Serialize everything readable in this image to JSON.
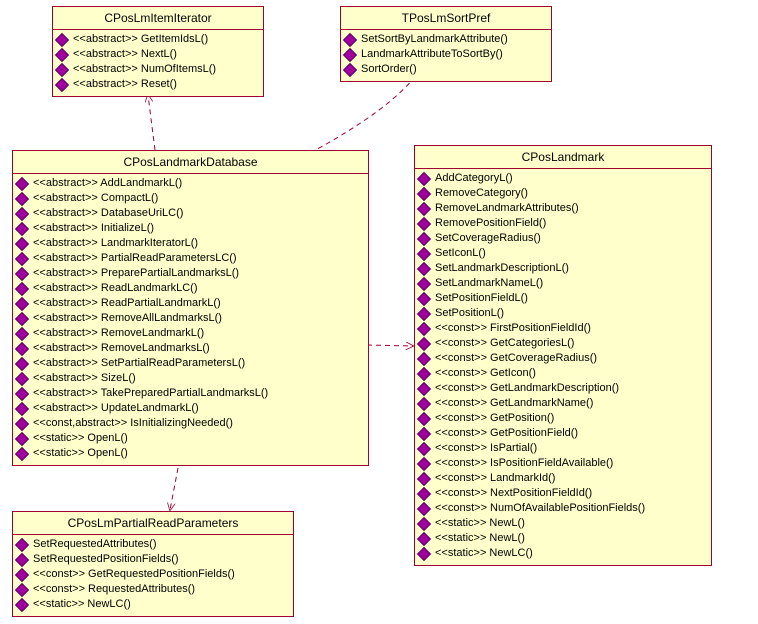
{
  "classes": {
    "iterator": {
      "title": "CPosLmItemIterator",
      "methods": [
        "<<abstract>> GetItemIdsL()",
        "<<abstract>> NextL()",
        "<<abstract>> NumOfItemsL()",
        "<<abstract>> Reset()"
      ]
    },
    "sortpref": {
      "title": "TPosLmSortPref",
      "methods": [
        "SetSortByLandmarkAttribute()",
        "LandmarkAttributeToSortBy()",
        "SortOrder()"
      ]
    },
    "database": {
      "title": "CPosLandmarkDatabase",
      "methods": [
        "<<abstract>> AddLandmarkL()",
        "<<abstract>> CompactL()",
        "<<abstract>> DatabaseUriLC()",
        "<<abstract>> InitializeL()",
        "<<abstract>> LandmarkIteratorL()",
        "<<abstract>> PartialReadParametersLC()",
        "<<abstract>> PreparePartialLandmarksL()",
        "<<abstract>> ReadLandmarkLC()",
        "<<abstract>> ReadPartialLandmarkL()",
        "<<abstract>> RemoveAllLandmarksL()",
        "<<abstract>> RemoveLandmarkL()",
        "<<abstract>> RemoveLandmarksL()",
        "<<abstract>> SetPartialReadParametersL()",
        "<<abstract>> SizeL()",
        "<<abstract>> TakePreparedPartialLandmarksL()",
        "<<abstract>> UpdateLandmarkL()",
        "<<const,abstract>> IsInitializingNeeded()",
        "<<static>> OpenL()",
        "<<static>> OpenL()"
      ]
    },
    "landmark": {
      "title": "CPosLandmark",
      "methods": [
        "AddCategoryL()",
        "RemoveCategory()",
        "RemoveLandmarkAttributes()",
        "RemovePositionField()",
        "SetCoverageRadius()",
        "SetIconL()",
        "SetLandmarkDescriptionL()",
        "SetLandmarkNameL()",
        "SetPositionFieldL()",
        "SetPositionL()",
        "<<const>> FirstPositionFieldId()",
        "<<const>> GetCategoriesL()",
        "<<const>> GetCoverageRadius()",
        "<<const>> GetIcon()",
        "<<const>> GetLandmarkDescription()",
        "<<const>> GetLandmarkName()",
        "<<const>> GetPosition()",
        "<<const>> GetPositionField()",
        "<<const>> IsPartial()",
        "<<const>> IsPositionFieldAvailable()",
        "<<const>> LandmarkId()",
        "<<const>> NextPositionFieldId()",
        "<<const>> NumOfAvailablePositionFields()",
        "<<static>> NewL()",
        "<<static>> NewL()",
        "<<static>> NewLC()"
      ]
    },
    "partialread": {
      "title": "CPosLmPartialReadParameters",
      "methods": [
        "SetRequestedAttributes()",
        "SetRequestedPositionFields()",
        "<<const>> GetRequestedPositionFields()",
        "<<const>> RequestedAttributes()",
        "<<static>> NewLC()"
      ]
    }
  }
}
